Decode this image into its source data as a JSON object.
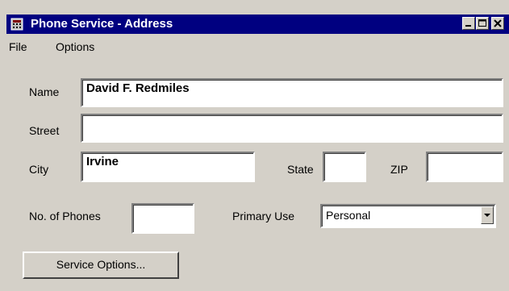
{
  "window": {
    "title": "Phone Service - Address",
    "icon": "phone-app-icon",
    "controls": [
      "minimize-icon",
      "maximize-icon",
      "close-icon"
    ]
  },
  "menu": {
    "items": [
      "File",
      "Options"
    ]
  },
  "form": {
    "name_label": "Name",
    "name_value": "David F. Redmiles",
    "street_label": "Street",
    "street_value": "",
    "city_label": "City",
    "city_value": "Irvine",
    "state_label": "State",
    "state_value": "",
    "zip_label": "ZIP",
    "zip_value": "",
    "phones_label": "No. of Phones",
    "phones_value": "",
    "primary_use_label": "Primary Use",
    "primary_use_value": "Personal"
  },
  "buttons": {
    "service_options": "Service Options..."
  },
  "colors": {
    "titlebar": "#000080",
    "face": "#d4d0c8"
  }
}
